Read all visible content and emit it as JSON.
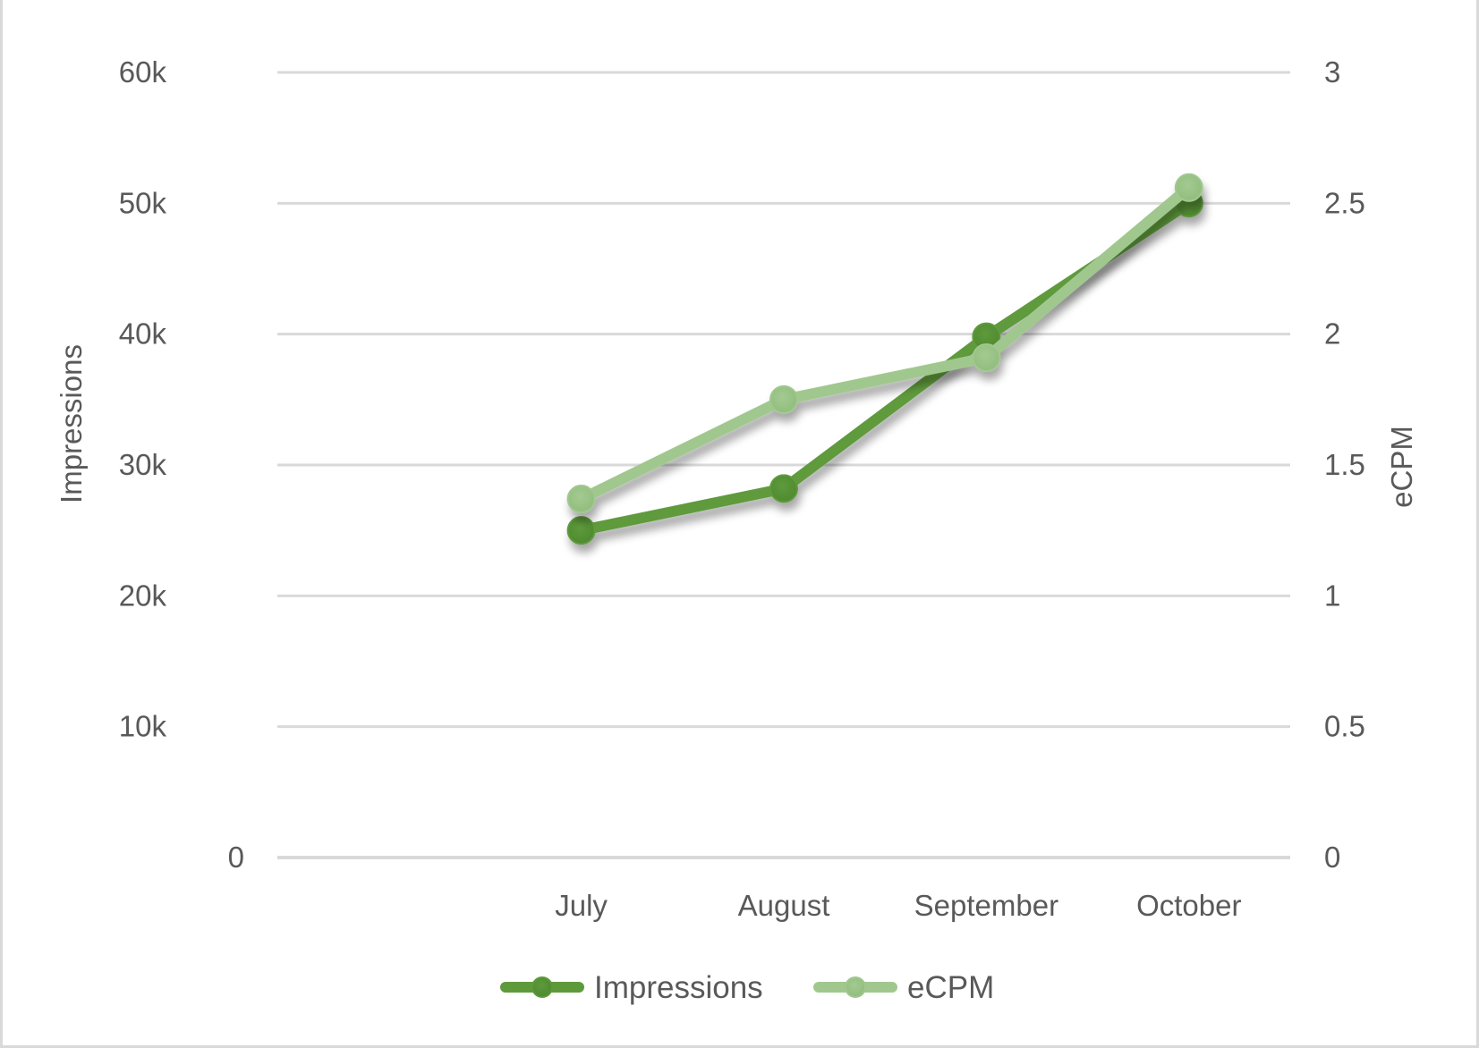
{
  "chart_data": {
    "type": "line",
    "title": "",
    "categories": [
      "July",
      "August",
      "September",
      "October"
    ],
    "leading_empty_categories": 1,
    "x": [
      "July",
      "August",
      "September",
      "October"
    ],
    "series": [
      {
        "name": "Impressions",
        "axis": "left",
        "color": "#5e9a3c",
        "values": [
          25000,
          28200,
          39800,
          50000
        ]
      },
      {
        "name": "eCPM",
        "axis": "right",
        "color": "#a0c88e",
        "values": [
          1.37,
          1.75,
          1.91,
          2.56
        ]
      }
    ],
    "y_left": {
      "label": "Impressions",
      "range": [
        0,
        60000
      ],
      "ticks": [
        0,
        10000,
        20000,
        30000,
        40000,
        50000,
        60000
      ],
      "tick_labels": [
        "0",
        "10k",
        "20k",
        "30k",
        "40k",
        "50k",
        "60k"
      ]
    },
    "y_right": {
      "label": "eCPM",
      "range": [
        0,
        3
      ],
      "ticks": [
        0,
        0.5,
        1,
        1.5,
        2,
        2.5,
        3
      ],
      "tick_labels": [
        "0",
        "0.5",
        "1",
        "1.5",
        "2",
        "2.5",
        "3"
      ]
    },
    "xlabel": "",
    "grid": true,
    "markers": true,
    "legend": {
      "position": "bottom",
      "entries": [
        "Impressions",
        "eCPM"
      ]
    }
  }
}
